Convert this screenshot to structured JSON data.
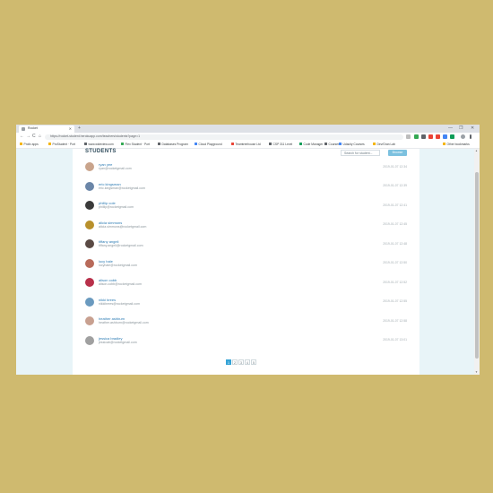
{
  "browser": {
    "tab_title": "Rocket",
    "tab_close": "✕",
    "new_tab": "+",
    "window_controls": [
      "—",
      "❐",
      "✕"
    ],
    "nav": [
      "←",
      "→",
      "C",
      "⌂"
    ],
    "url": "https://rocket-student.herokuapp.com/teachers/students?page=1",
    "bookmarks": [
      {
        "label": "Prolix apps",
        "color": "#f4b400"
      },
      {
        "label": "ProStudent · Port",
        "color": "#f4b400"
      },
      {
        "label": "www.wideview.com",
        "color": "#5f6368"
      },
      {
        "label": "Flex Student · Port",
        "color": "#34a853"
      },
      {
        "label": "Databases Program",
        "color": "#5f6368"
      },
      {
        "label": "Cloud Playground",
        "color": "#4285f4"
      },
      {
        "label": "Teamtreehouse Ltd",
        "color": "#ea4335"
      },
      {
        "label": "CSP 311 Level",
        "color": "#5f6368"
      },
      {
        "label": "Code Manager",
        "color": "#0f9d58"
      },
      {
        "label": "Coursera",
        "color": "#5f6368"
      },
      {
        "label": "Udacity Courses",
        "color": "#4285f4"
      },
      {
        "label": "Dev/Gran Lab",
        "color": "#f4b400"
      }
    ],
    "other_bookmarks": "Other bookmarks"
  },
  "page": {
    "heading": "STUDENTS",
    "search_placeholder": "Search for student...",
    "search_button": "Browse"
  },
  "students": [
    {
      "name": "ryan yee",
      "email": "ryan@rocketgmail.com",
      "date": "2019-01-07 12:34",
      "avatar": "#c9a48c"
    },
    {
      "name": "eric kingsman",
      "email": "eric.kingsman@rocketgmail.com",
      "date": "2019-01-07 12:39",
      "avatar": "#6b86a8"
    },
    {
      "name": "phillip cole",
      "email": "phillip@rocketgmail.com",
      "date": "2019-01-07 12:41",
      "avatar": "#3a3a3a"
    },
    {
      "name": "alicia simmons",
      "email": "alicia.simmons@rocketgmail.com",
      "date": "2019-01-07 12:45",
      "avatar": "#b8902c"
    },
    {
      "name": "tiffany angeli",
      "email": "tiffany.angeli@rocketgmail.com",
      "date": "2019-01-07 12:48",
      "avatar": "#5a4a44"
    },
    {
      "name": "lucy hale",
      "email": "lucyhale@rocketgmail.com",
      "date": "2019-01-07 12:50",
      "avatar": "#b86a5a"
    },
    {
      "name": "alison cobb",
      "email": "alison.cobb@rocketgmail.com",
      "date": "2019-01-07 12:52",
      "avatar": "#b8304a"
    },
    {
      "name": "nikki brees",
      "email": "nikkibrees@rocketgmail.com",
      "date": "2019-01-07 12:55",
      "avatar": "#6a9abf"
    },
    {
      "name": "heather ashburn",
      "email": "heather.ashburn@rocketgmail.com",
      "date": "2019-01-07 12:58",
      "avatar": "#c8a090"
    },
    {
      "name": "jessica bradley",
      "email": "jessicab@rocketgmail.com",
      "date": "2019-01-07 13:01",
      "avatar": "#a0a0a0"
    }
  ],
  "pagination": [
    "1",
    "2",
    "3",
    "4",
    "5"
  ],
  "active_page": "1"
}
